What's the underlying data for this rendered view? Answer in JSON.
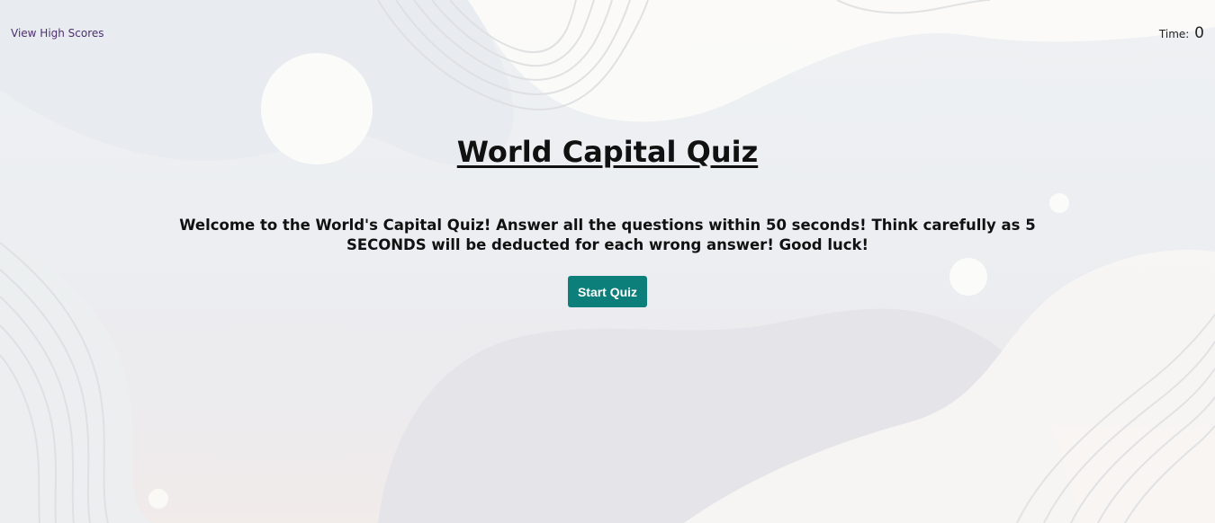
{
  "nav": {
    "high_scores_label": "View High Scores"
  },
  "timer": {
    "label": "Time:",
    "value": "0"
  },
  "quiz": {
    "title": "World Capital Quiz",
    "intro": "Welcome to the World's Capital Quiz! Answer all the questions within 50 seconds! Think carefully as 5 SECONDS will be deducted for each wrong answer! Good luck!",
    "start_label": "Start Quiz"
  },
  "colors": {
    "button_bg": "#0d7f7b",
    "link": "#4d2f6e",
    "text": "#111111"
  }
}
